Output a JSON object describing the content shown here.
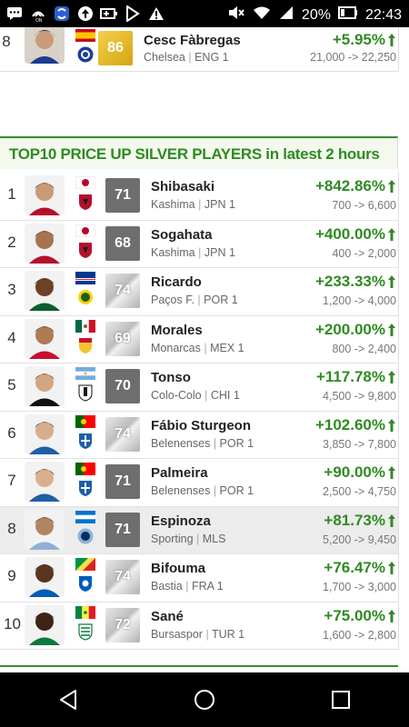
{
  "status_bar": {
    "battery": "20%",
    "time": "22:43",
    "left_icons": [
      "chat-icon",
      "nfc-icon",
      "sync-icon",
      "upload-icon",
      "battery-charging-icon",
      "play-icon",
      "warning-icon"
    ],
    "right_icons": [
      "mute-icon",
      "wifi-icon",
      "signal-icon",
      "battery-icon"
    ]
  },
  "top_player": {
    "rank": "8",
    "name": "Cesc Fàbregas",
    "rating": "86",
    "club": "Chelsea",
    "league": "ENG 1",
    "change": "+5.95%",
    "price": "21,000 -> 22,250"
  },
  "section": {
    "title": "TOP10 PRICE UP SILVER PLAYERS in latest 2 hours"
  },
  "players": [
    {
      "rank": "1",
      "name": "Shibasaki",
      "club": "Kashima",
      "league": "JPN 1",
      "rating": "71",
      "rating_style": "dark",
      "change": "+842.86%",
      "price": "700 -> 6,600",
      "flag": "jpn",
      "crest": "kashima",
      "highlight": false
    },
    {
      "rank": "2",
      "name": "Sogahata",
      "club": "Kashima",
      "league": "JPN 1",
      "rating": "68",
      "rating_style": "dark",
      "change": "+400.00%",
      "price": "400 -> 2,000",
      "flag": "jpn",
      "crest": "kashima",
      "highlight": false
    },
    {
      "rank": "3",
      "name": "Ricardo",
      "club": "Paços F.",
      "league": "POR 1",
      "rating": "74",
      "rating_style": "silver",
      "change": "+233.33%",
      "price": "1,200 -> 4,000",
      "flag": "cpv",
      "crest": "pacos",
      "highlight": false
    },
    {
      "rank": "4",
      "name": "Morales",
      "club": "Monarcas",
      "league": "MEX 1",
      "rating": "69",
      "rating_style": "silver",
      "change": "+200.00%",
      "price": "800 -> 2,400",
      "flag": "mex",
      "crest": "monarcas",
      "highlight": false
    },
    {
      "rank": "5",
      "name": "Tonso",
      "club": "Colo-Colo",
      "league": "CHI 1",
      "rating": "70",
      "rating_style": "dark",
      "change": "+117.78%",
      "price": "4,500 -> 9,800",
      "flag": "arg",
      "crest": "colocolo",
      "highlight": false
    },
    {
      "rank": "6",
      "name": "Fábio Sturgeon",
      "club": "Belenenses",
      "league": "POR 1",
      "rating": "74",
      "rating_style": "silver",
      "change": "+102.60%",
      "price": "3,850 -> 7,800",
      "flag": "por",
      "crest": "belenenses",
      "highlight": false
    },
    {
      "rank": "7",
      "name": "Palmeira",
      "club": "Belenenses",
      "league": "POR 1",
      "rating": "71",
      "rating_style": "dark",
      "change": "+90.00%",
      "price": "2,500 -> 4,750",
      "flag": "por",
      "crest": "belenenses",
      "highlight": false
    },
    {
      "rank": "8",
      "name": "Espinoza",
      "club": "Sporting",
      "league": "MLS",
      "rating": "71",
      "rating_style": "dark",
      "change": "+81.73%",
      "price": "5,200 -> 9,450",
      "flag": "hon",
      "crest": "sporting",
      "highlight": true
    },
    {
      "rank": "9",
      "name": "Bifouma",
      "club": "Bastia",
      "league": "FRA 1",
      "rating": "74",
      "rating_style": "silver",
      "change": "+76.47%",
      "price": "1,700 -> 3,000",
      "flag": "cgo",
      "crest": "bastia",
      "highlight": false
    },
    {
      "rank": "10",
      "name": "Sané",
      "club": "Bursaspor",
      "league": "TUR 1",
      "rating": "72",
      "rating_style": "silver",
      "change": "+75.00%",
      "price": "1,600 -> 2,800",
      "flag": "sen",
      "crest": "bursaspor",
      "highlight": false
    }
  ],
  "separator": "|",
  "colors": {
    "accent_green": "#2e8b22",
    "header_bg": "#f4f9ee",
    "highlight_row": "#ececec"
  },
  "nav_bar": {
    "buttons": [
      "back-button",
      "home-button",
      "recents-button"
    ]
  }
}
